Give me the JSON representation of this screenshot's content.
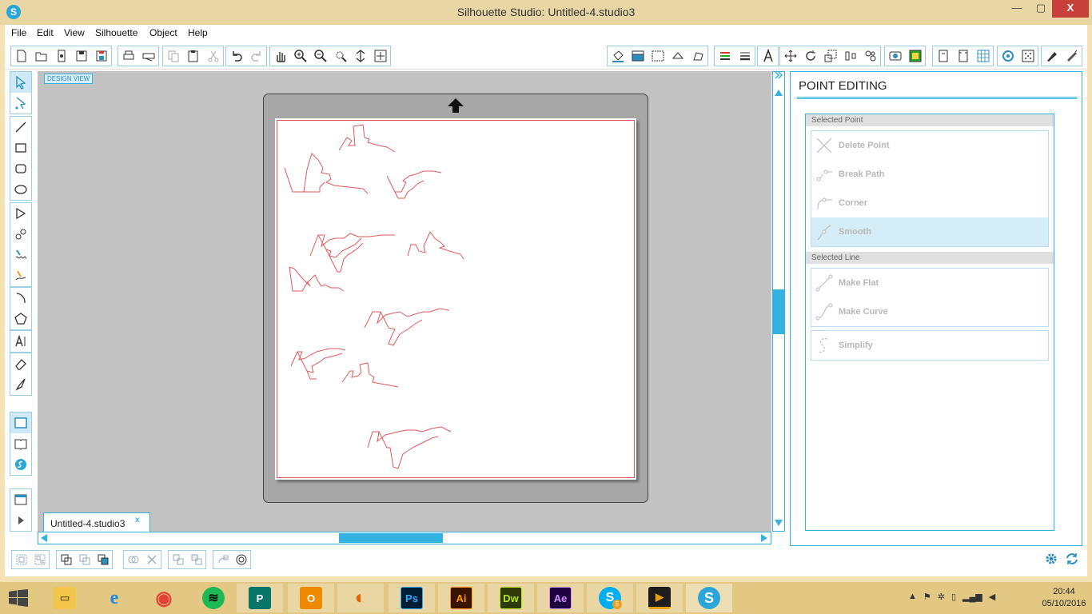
{
  "window": {
    "title": "Silhouette Studio: Untitled-4.studio3",
    "app_icon": "S",
    "min": "—",
    "max": "▢",
    "close": "X"
  },
  "menu": [
    "File",
    "Edit",
    "View",
    "Silhouette",
    "Object",
    "Help"
  ],
  "canvas": {
    "view_label": "DESIGN VIEW",
    "doc_tab": "Untitled-4.studio3",
    "doc_tab_close": "x"
  },
  "panel": {
    "title": "POINT EDITING",
    "selected_point_header": "Selected Point",
    "selected_point_items": [
      {
        "label": "Delete Point",
        "icon": "delete-point-icon"
      },
      {
        "label": "Break Path",
        "icon": "break-path-icon"
      },
      {
        "label": "Corner",
        "icon": "corner-icon"
      },
      {
        "label": "Smooth",
        "icon": "smooth-icon"
      }
    ],
    "selected_line_header": "Selected Line",
    "selected_line_items": [
      {
        "label": "Make Flat",
        "icon": "make-flat-icon"
      },
      {
        "label": "Make Curve",
        "icon": "make-curve-icon"
      }
    ],
    "simplify": {
      "label": "Simplify",
      "icon": "simplify-icon"
    }
  },
  "taskbar": {
    "apps": [
      {
        "name": "File Explorer",
        "glyph": "▭",
        "color": "#f2c64b"
      },
      {
        "name": "Internet Explorer",
        "glyph": "e",
        "color": "#1e88e5"
      },
      {
        "name": "Chrome",
        "glyph": "◉",
        "color": "#e34133"
      },
      {
        "name": "Spotify",
        "glyph": "≋",
        "color": "#1db954"
      },
      {
        "name": "Publisher",
        "glyph": "P",
        "color": "#077568"
      },
      {
        "name": "Outlook",
        "glyph": "O",
        "color": "#f08a00"
      },
      {
        "name": "Firefox",
        "glyph": "◐",
        "color": "#e66000"
      },
      {
        "name": "Photoshop",
        "glyph": "Ps",
        "color": "#001d34"
      },
      {
        "name": "Illustrator",
        "glyph": "Ai",
        "color": "#3a1200"
      },
      {
        "name": "Dreamweaver",
        "glyph": "Dw",
        "color": "#2e3a08"
      },
      {
        "name": "After Effects",
        "glyph": "Ae",
        "color": "#1f0040"
      },
      {
        "name": "Skype",
        "glyph": "S",
        "color": "#00aff0"
      },
      {
        "name": "Plex",
        "glyph": "▶",
        "color": "#e5a00d"
      },
      {
        "name": "Silhouette Studio",
        "glyph": "S",
        "color": "#2aa7d8"
      }
    ],
    "skype_badge": "5",
    "time": "20:44",
    "date": "05/10/2016"
  },
  "colors": {
    "accent": "#33b1df",
    "cut_line": "#e05a5a",
    "mat": "#a7a7a7",
    "canvas_bg": "#c2c2c2",
    "taskbar": "#e2c883"
  }
}
